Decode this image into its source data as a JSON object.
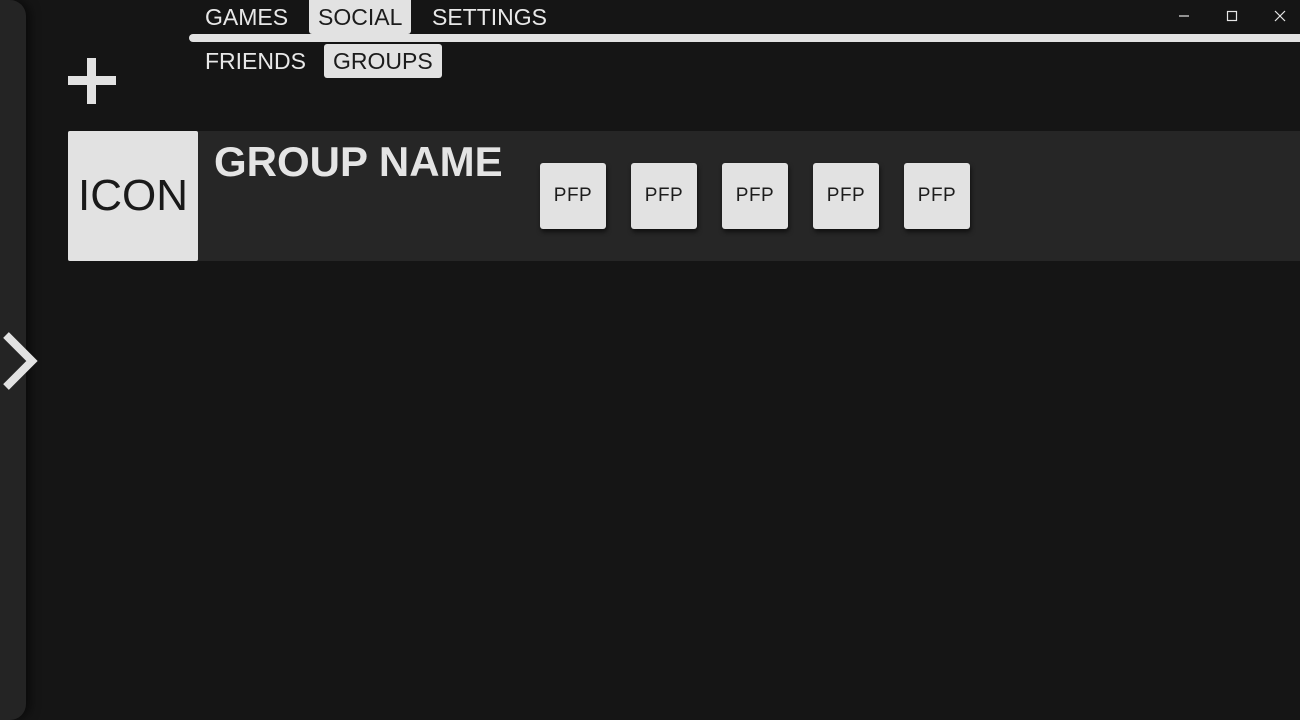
{
  "nav": {
    "main_tabs": [
      "GAMES",
      "SOCIAL",
      "SETTINGS"
    ],
    "active_main_tab": "SOCIAL",
    "sub_tabs": [
      "FRIENDS",
      "GROUPS"
    ],
    "active_sub_tab": "GROUPS"
  },
  "icons": {
    "sidebar_toggle": "chevron-right-icon",
    "add": "plus-icon",
    "minimize": "minimize-icon",
    "maximize": "maximize-icon",
    "close": "close-icon"
  },
  "group": {
    "icon_label": "ICON",
    "name": "GROUP NAME",
    "members": [
      "PFP",
      "PFP",
      "PFP",
      "PFP",
      "PFP"
    ]
  },
  "colors": {
    "background": "#151515",
    "sidebar": "#242424",
    "card": "#262626",
    "light": "#e2e2e2"
  }
}
